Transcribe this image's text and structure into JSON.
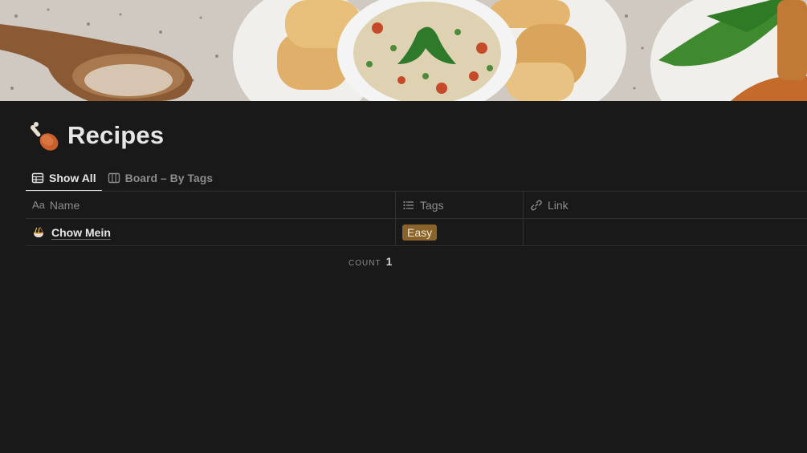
{
  "page": {
    "title": "Recipes",
    "icon": "poultry-leg-icon"
  },
  "tabs": [
    {
      "label": "Show All",
      "icon": "table-icon",
      "active": true
    },
    {
      "label": "Board – By Tags",
      "icon": "board-icon",
      "active": false
    }
  ],
  "table": {
    "columns": [
      {
        "label": "Name",
        "type_marker": "Aa"
      },
      {
        "label": "Tags",
        "icon": "list-icon"
      },
      {
        "label": "Link",
        "icon": "link-icon"
      }
    ],
    "rows": [
      {
        "name": "Chow Mein",
        "icon": "noodle-bowl-icon",
        "tags": [
          "Easy"
        ],
        "link": ""
      }
    ],
    "count_label": "COUNT",
    "count_value": "1"
  },
  "colors": {
    "background": "#191919",
    "tag_easy": "#89632a"
  }
}
